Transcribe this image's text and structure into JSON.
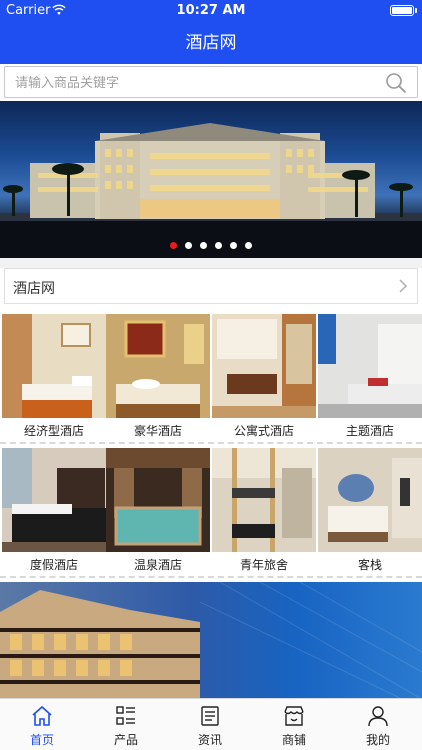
{
  "status": {
    "carrier": "Carrier",
    "time": "10:27 AM"
  },
  "header": {
    "title": "酒店网"
  },
  "search": {
    "placeholder": "请输入商品关键字"
  },
  "banner": {
    "dots_count": 6,
    "active_index": 0
  },
  "section": {
    "label": "酒店网"
  },
  "categories": [
    {
      "label": "经济型酒店"
    },
    {
      "label": "豪华酒店"
    },
    {
      "label": "公寓式酒店"
    },
    {
      "label": "主题酒店"
    },
    {
      "label": "度假酒店"
    },
    {
      "label": "温泉酒店"
    },
    {
      "label": "青年旅舍"
    },
    {
      "label": "客栈"
    }
  ],
  "tabbar": {
    "items": [
      {
        "label": "首页",
        "icon": "home-icon",
        "active": true
      },
      {
        "label": "产品",
        "icon": "grid-list-icon",
        "active": false
      },
      {
        "label": "资讯",
        "icon": "news-icon",
        "active": false
      },
      {
        "label": "商铺",
        "icon": "store-icon",
        "active": false
      },
      {
        "label": "我的",
        "icon": "user-icon",
        "active": false
      }
    ]
  },
  "colors": {
    "brand": "#1f4ff0",
    "active_dot": "#e61e1e"
  }
}
